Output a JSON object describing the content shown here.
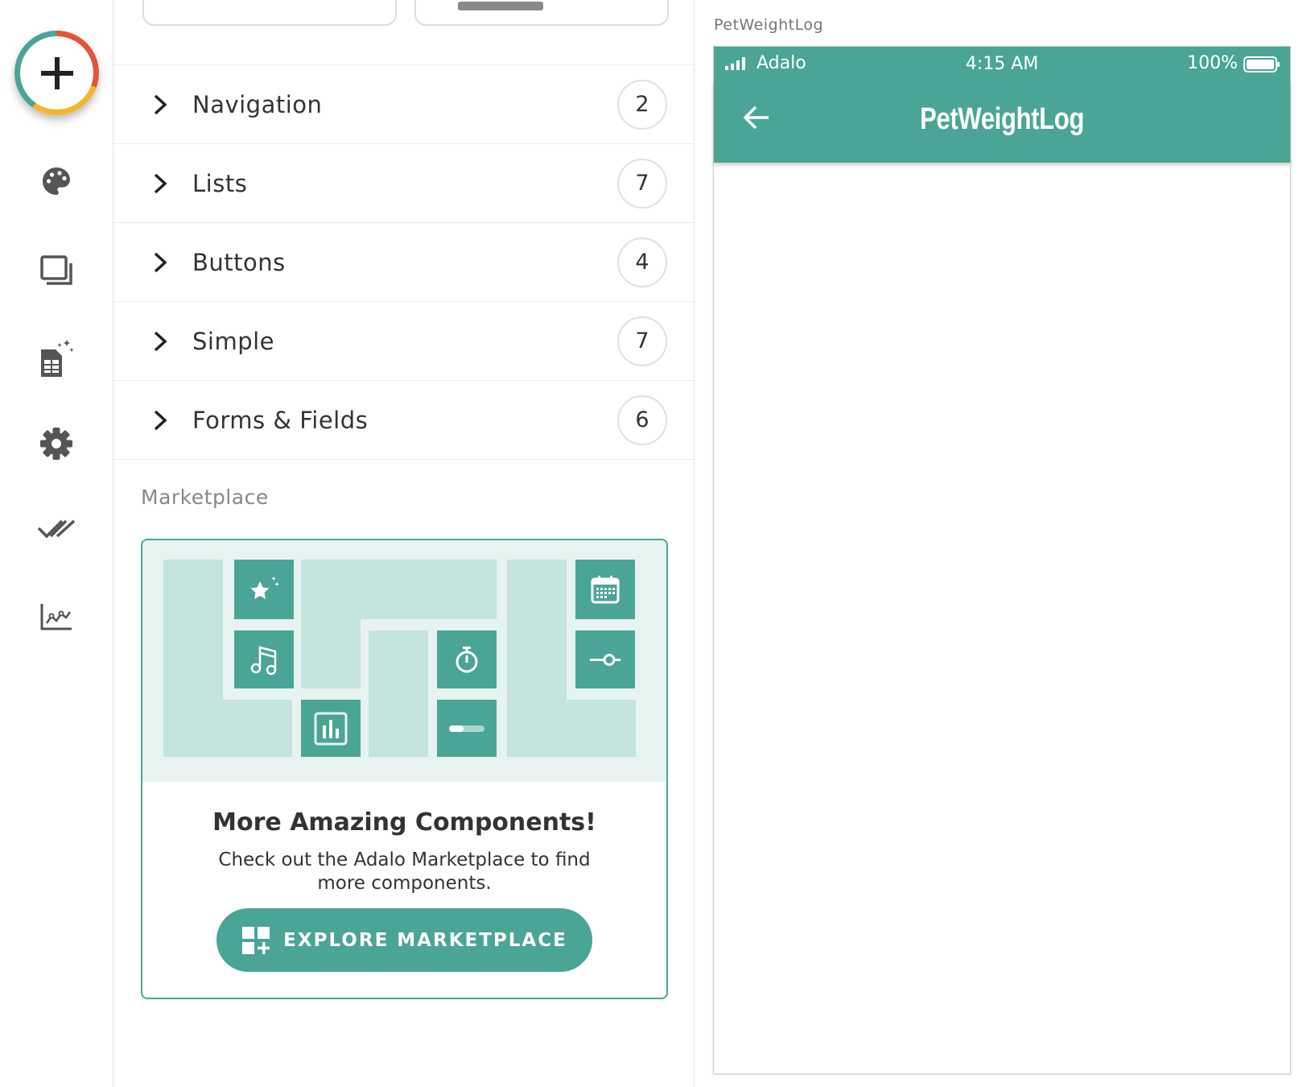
{
  "toolbar": {
    "add_button_icon": "plus-icon",
    "icons": [
      "palette-icon",
      "screens-icon",
      "database-icon",
      "settings-icon",
      "publish-check-icon",
      "analytics-icon"
    ]
  },
  "panel": {
    "categories": [
      {
        "label": "Navigation",
        "count": "2"
      },
      {
        "label": "Lists",
        "count": "7"
      },
      {
        "label": "Buttons",
        "count": "4"
      },
      {
        "label": "Simple",
        "count": "7"
      },
      {
        "label": "Forms & Fields",
        "count": "6"
      }
    ],
    "marketplace": {
      "heading": "Marketplace",
      "title": "More Amazing Components!",
      "description": "Check out the Adalo Marketplace to find more components.",
      "button_label": "EXPLORE MARKETPLACE"
    }
  },
  "preview": {
    "label": "PetWeightLog",
    "status": {
      "carrier": "Adalo",
      "time": "4:15 AM",
      "battery": "100%"
    },
    "app_title": "PetWeightLog"
  },
  "colors": {
    "accent": "#4aa596",
    "accent_light": "#c3e4df",
    "accent_bg": "#e7f3f1"
  }
}
